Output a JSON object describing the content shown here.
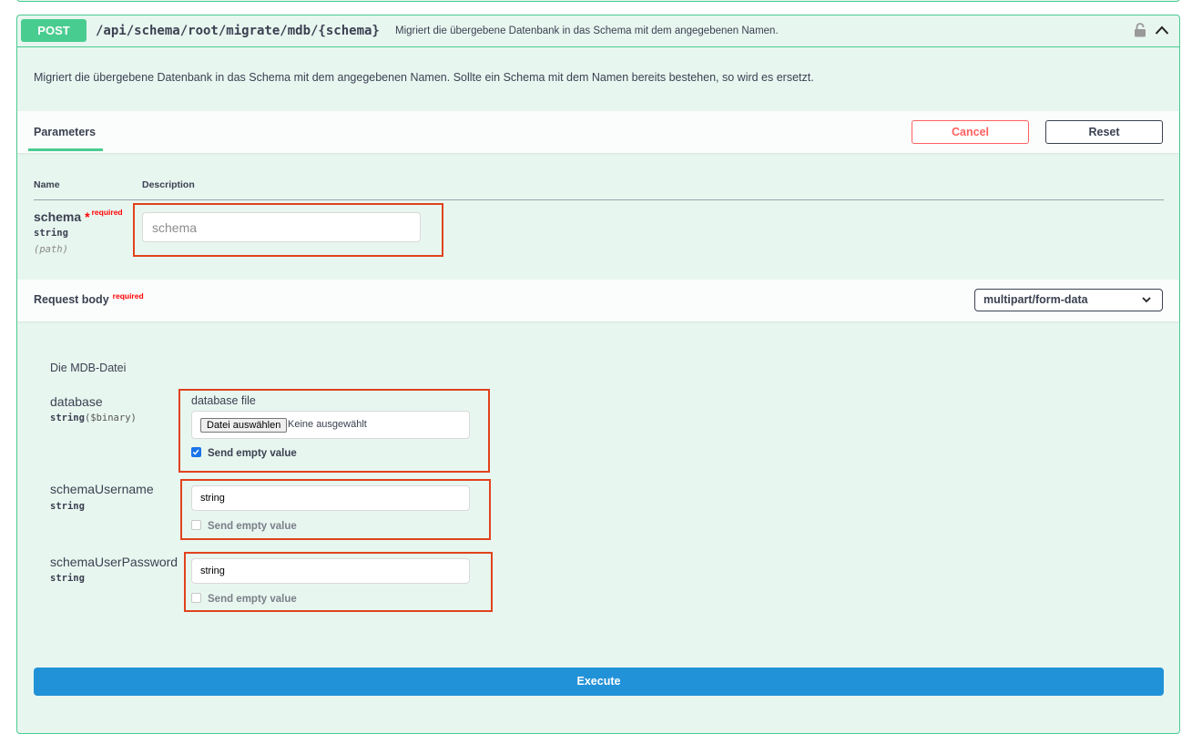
{
  "operation": {
    "method": "POST",
    "path": "/api/schema/root/migrate/mdb/{schema}",
    "summary": "Migriert die übergebene Datenbank in das Schema mit dem angegebenen Namen.",
    "description": "Migriert die übergebene Datenbank in das Schema mit dem angegebenen Namen. Sollte ein Schema mit dem Namen bereits bestehen, so wird es ersetzt.",
    "lock_icon": "lock-icon",
    "collapse_icon": "chevron-up-icon"
  },
  "parameters": {
    "tab_label": "Parameters",
    "cancel_label": "Cancel",
    "reset_label": "Reset",
    "col_name": "Name",
    "col_description": "Description",
    "items": [
      {
        "name": "schema",
        "required_star": "*",
        "required_label": "required",
        "type": "string",
        "in": "(path)",
        "placeholder": "schema",
        "value": ""
      }
    ]
  },
  "request_body": {
    "title": "Request body",
    "required_label": "required",
    "content_type": "multipart/form-data",
    "schema_description": "Die MDB-Datei",
    "fields": [
      {
        "name": "database",
        "type": "string",
        "format": "($binary)",
        "file_label": "database file",
        "file_button": "Datei auswählen",
        "file_status": "Keine ausgewählt",
        "send_empty_label": "Send empty value",
        "send_empty_checked": true
      },
      {
        "name": "schemaUsername",
        "type": "string",
        "value": "string",
        "send_empty_label": "Send empty value",
        "send_empty_checked": false
      },
      {
        "name": "schemaUserPassword",
        "type": "string",
        "value": "string",
        "send_empty_label": "Send empty value",
        "send_empty_checked": false
      }
    ]
  },
  "execute_label": "Execute",
  "colors": {
    "post_green": "#49cc90",
    "panel_bg": "#e8f6f0",
    "cancel_red": "#ff6060",
    "execute_blue": "#2292d8",
    "highlight_orange": "#e0431d"
  }
}
